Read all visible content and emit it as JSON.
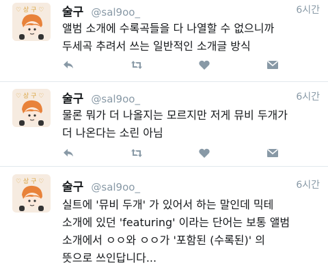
{
  "tweets": [
    {
      "display_name": "술구",
      "handle": "@sal9oo_",
      "time": "6시간",
      "lines": [
        "앨범 소개에 수록곡들을 다 나열할 수 없으니까",
        "두세곡 추려서 쓰는 일반적인 소개글 방식"
      ]
    },
    {
      "display_name": "술구",
      "handle": "@sal9oo_",
      "time": "6시간",
      "lines": [
        "물론 뭐가 더 나올지는 모르지만 저게 뮤비 두개가",
        "더 나온다는 소린 아님"
      ]
    },
    {
      "display_name": "술구",
      "handle": "@sal9oo_",
      "time": "6시간",
      "lines": [
        "실트에 '뮤비 두개' 가 있어서 하는 말인데 믹테",
        "소개에 있던 'featuring' 이라는 단어는 보통 앨범",
        "소개에서 ㅇㅇ와 ㅇㅇ가 '포함된 (수록된)' 의",
        "뜻으로 쓰인답니다..."
      ]
    }
  ],
  "colors": {
    "text": "#14171a",
    "muted": "#8899a6",
    "divider": "#e1e8ed",
    "avatar_bg": "#f6ebe0",
    "avatar_hair": "#e8823a"
  },
  "icons": [
    "reply-icon",
    "retweet-icon",
    "like-icon",
    "direct-message-icon"
  ]
}
